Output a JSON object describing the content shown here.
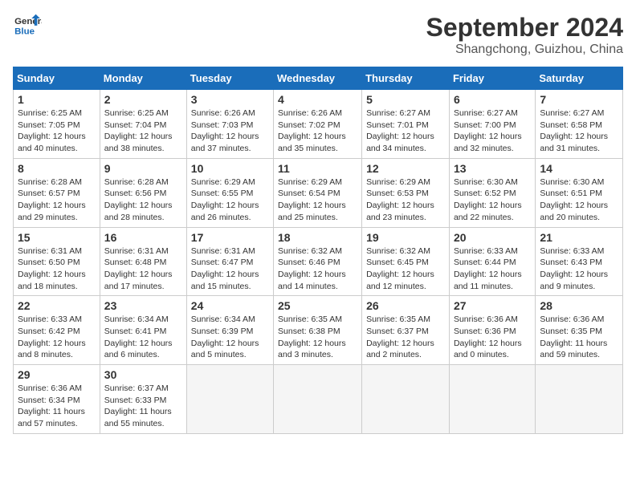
{
  "header": {
    "logo_line1": "General",
    "logo_line2": "Blue",
    "month": "September 2024",
    "location": "Shangchong, Guizhou, China"
  },
  "columns": [
    "Sunday",
    "Monday",
    "Tuesday",
    "Wednesday",
    "Thursday",
    "Friday",
    "Saturday"
  ],
  "weeks": [
    [
      {
        "day": "1",
        "sunrise": "Sunrise: 6:25 AM",
        "sunset": "Sunset: 7:05 PM",
        "daylight": "Daylight: 12 hours and 40 minutes."
      },
      {
        "day": "2",
        "sunrise": "Sunrise: 6:25 AM",
        "sunset": "Sunset: 7:04 PM",
        "daylight": "Daylight: 12 hours and 38 minutes."
      },
      {
        "day": "3",
        "sunrise": "Sunrise: 6:26 AM",
        "sunset": "Sunset: 7:03 PM",
        "daylight": "Daylight: 12 hours and 37 minutes."
      },
      {
        "day": "4",
        "sunrise": "Sunrise: 6:26 AM",
        "sunset": "Sunset: 7:02 PM",
        "daylight": "Daylight: 12 hours and 35 minutes."
      },
      {
        "day": "5",
        "sunrise": "Sunrise: 6:27 AM",
        "sunset": "Sunset: 7:01 PM",
        "daylight": "Daylight: 12 hours and 34 minutes."
      },
      {
        "day": "6",
        "sunrise": "Sunrise: 6:27 AM",
        "sunset": "Sunset: 7:00 PM",
        "daylight": "Daylight: 12 hours and 32 minutes."
      },
      {
        "day": "7",
        "sunrise": "Sunrise: 6:27 AM",
        "sunset": "Sunset: 6:58 PM",
        "daylight": "Daylight: 12 hours and 31 minutes."
      }
    ],
    [
      {
        "day": "8",
        "sunrise": "Sunrise: 6:28 AM",
        "sunset": "Sunset: 6:57 PM",
        "daylight": "Daylight: 12 hours and 29 minutes."
      },
      {
        "day": "9",
        "sunrise": "Sunrise: 6:28 AM",
        "sunset": "Sunset: 6:56 PM",
        "daylight": "Daylight: 12 hours and 28 minutes."
      },
      {
        "day": "10",
        "sunrise": "Sunrise: 6:29 AM",
        "sunset": "Sunset: 6:55 PM",
        "daylight": "Daylight: 12 hours and 26 minutes."
      },
      {
        "day": "11",
        "sunrise": "Sunrise: 6:29 AM",
        "sunset": "Sunset: 6:54 PM",
        "daylight": "Daylight: 12 hours and 25 minutes."
      },
      {
        "day": "12",
        "sunrise": "Sunrise: 6:29 AM",
        "sunset": "Sunset: 6:53 PM",
        "daylight": "Daylight: 12 hours and 23 minutes."
      },
      {
        "day": "13",
        "sunrise": "Sunrise: 6:30 AM",
        "sunset": "Sunset: 6:52 PM",
        "daylight": "Daylight: 12 hours and 22 minutes."
      },
      {
        "day": "14",
        "sunrise": "Sunrise: 6:30 AM",
        "sunset": "Sunset: 6:51 PM",
        "daylight": "Daylight: 12 hours and 20 minutes."
      }
    ],
    [
      {
        "day": "15",
        "sunrise": "Sunrise: 6:31 AM",
        "sunset": "Sunset: 6:50 PM",
        "daylight": "Daylight: 12 hours and 18 minutes."
      },
      {
        "day": "16",
        "sunrise": "Sunrise: 6:31 AM",
        "sunset": "Sunset: 6:48 PM",
        "daylight": "Daylight: 12 hours and 17 minutes."
      },
      {
        "day": "17",
        "sunrise": "Sunrise: 6:31 AM",
        "sunset": "Sunset: 6:47 PM",
        "daylight": "Daylight: 12 hours and 15 minutes."
      },
      {
        "day": "18",
        "sunrise": "Sunrise: 6:32 AM",
        "sunset": "Sunset: 6:46 PM",
        "daylight": "Daylight: 12 hours and 14 minutes."
      },
      {
        "day": "19",
        "sunrise": "Sunrise: 6:32 AM",
        "sunset": "Sunset: 6:45 PM",
        "daylight": "Daylight: 12 hours and 12 minutes."
      },
      {
        "day": "20",
        "sunrise": "Sunrise: 6:33 AM",
        "sunset": "Sunset: 6:44 PM",
        "daylight": "Daylight: 12 hours and 11 minutes."
      },
      {
        "day": "21",
        "sunrise": "Sunrise: 6:33 AM",
        "sunset": "Sunset: 6:43 PM",
        "daylight": "Daylight: 12 hours and 9 minutes."
      }
    ],
    [
      {
        "day": "22",
        "sunrise": "Sunrise: 6:33 AM",
        "sunset": "Sunset: 6:42 PM",
        "daylight": "Daylight: 12 hours and 8 minutes."
      },
      {
        "day": "23",
        "sunrise": "Sunrise: 6:34 AM",
        "sunset": "Sunset: 6:41 PM",
        "daylight": "Daylight: 12 hours and 6 minutes."
      },
      {
        "day": "24",
        "sunrise": "Sunrise: 6:34 AM",
        "sunset": "Sunset: 6:39 PM",
        "daylight": "Daylight: 12 hours and 5 minutes."
      },
      {
        "day": "25",
        "sunrise": "Sunrise: 6:35 AM",
        "sunset": "Sunset: 6:38 PM",
        "daylight": "Daylight: 12 hours and 3 minutes."
      },
      {
        "day": "26",
        "sunrise": "Sunrise: 6:35 AM",
        "sunset": "Sunset: 6:37 PM",
        "daylight": "Daylight: 12 hours and 2 minutes."
      },
      {
        "day": "27",
        "sunrise": "Sunrise: 6:36 AM",
        "sunset": "Sunset: 6:36 PM",
        "daylight": "Daylight: 12 hours and 0 minutes."
      },
      {
        "day": "28",
        "sunrise": "Sunrise: 6:36 AM",
        "sunset": "Sunset: 6:35 PM",
        "daylight": "Daylight: 11 hours and 59 minutes."
      }
    ],
    [
      {
        "day": "29",
        "sunrise": "Sunrise: 6:36 AM",
        "sunset": "Sunset: 6:34 PM",
        "daylight": "Daylight: 11 hours and 57 minutes."
      },
      {
        "day": "30",
        "sunrise": "Sunrise: 6:37 AM",
        "sunset": "Sunset: 6:33 PM",
        "daylight": "Daylight: 11 hours and 55 minutes."
      },
      null,
      null,
      null,
      null,
      null
    ]
  ]
}
